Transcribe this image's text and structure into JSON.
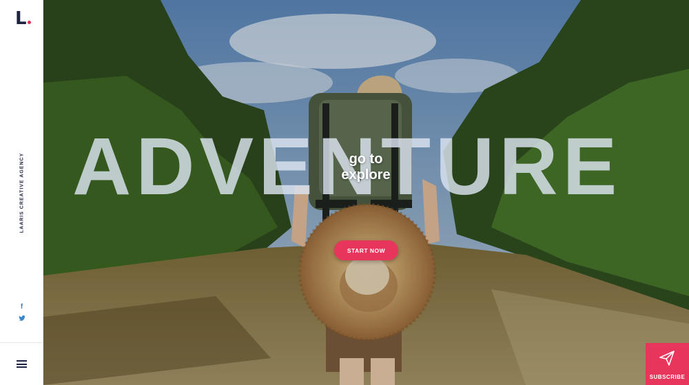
{
  "brand": {
    "logo_text": "L",
    "tagline_vertical": "LAARIS CREATIVE AGENCY",
    "accent": "#e8355c",
    "navy": "#1d2340"
  },
  "social": {
    "facebook": "f",
    "twitter": "twitter-icon"
  },
  "hero": {
    "headline": "ADVENTURE",
    "tagline_line1": "go to",
    "tagline_line2": "explore",
    "cta_label": "START NOW"
  },
  "subscribe": {
    "label": "SUBSCRIBE",
    "icon": "paper-plane-icon"
  },
  "menu": {
    "icon": "hamburger-menu-icon"
  }
}
